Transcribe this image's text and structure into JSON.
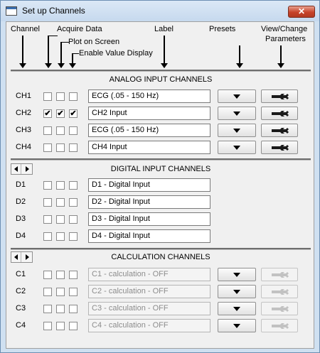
{
  "window": {
    "title": "Set up Channels",
    "close_label": "✕"
  },
  "headers": {
    "channel": "Channel",
    "acquire": "Acquire Data",
    "plot": "Plot on Screen",
    "enable": "Enable Value Display",
    "label": "Label",
    "presets": "Presets",
    "view_change_1": "View/Change",
    "view_change_2": "Parameters"
  },
  "analog": {
    "title": "ANALOG  INPUT  CHANNELS",
    "rows": [
      {
        "id": "CH1",
        "label": "ECG (.05 - 150 Hz)",
        "acquire": false,
        "plot": false,
        "enable": false
      },
      {
        "id": "CH2",
        "label": "CH2 Input",
        "acquire": true,
        "plot": true,
        "enable": true
      },
      {
        "id": "CH3",
        "label": "ECG (.05 - 150 Hz)",
        "acquire": false,
        "plot": false,
        "enable": false
      },
      {
        "id": "CH4",
        "label": "CH4 Input",
        "acquire": false,
        "plot": false,
        "enable": false
      }
    ]
  },
  "digital": {
    "title": "DIGITAL INPUT CHANNELS",
    "rows": [
      {
        "id": "D1",
        "label": "D1 - Digital Input"
      },
      {
        "id": "D2",
        "label": "D2 - Digital Input"
      },
      {
        "id": "D3",
        "label": "D3 - Digital Input"
      },
      {
        "id": "D4",
        "label": "D4 - Digital Input"
      }
    ]
  },
  "calculation": {
    "title": "CALCULATION  CHANNELS",
    "rows": [
      {
        "id": "C1",
        "label": "C1 - calculation - OFF"
      },
      {
        "id": "C2",
        "label": "C2 - calculation - OFF"
      },
      {
        "id": "C3",
        "label": "C3 - calculation - OFF"
      },
      {
        "id": "C4",
        "label": "C4 - calculation - OFF"
      }
    ]
  },
  "check_mark": "✔"
}
